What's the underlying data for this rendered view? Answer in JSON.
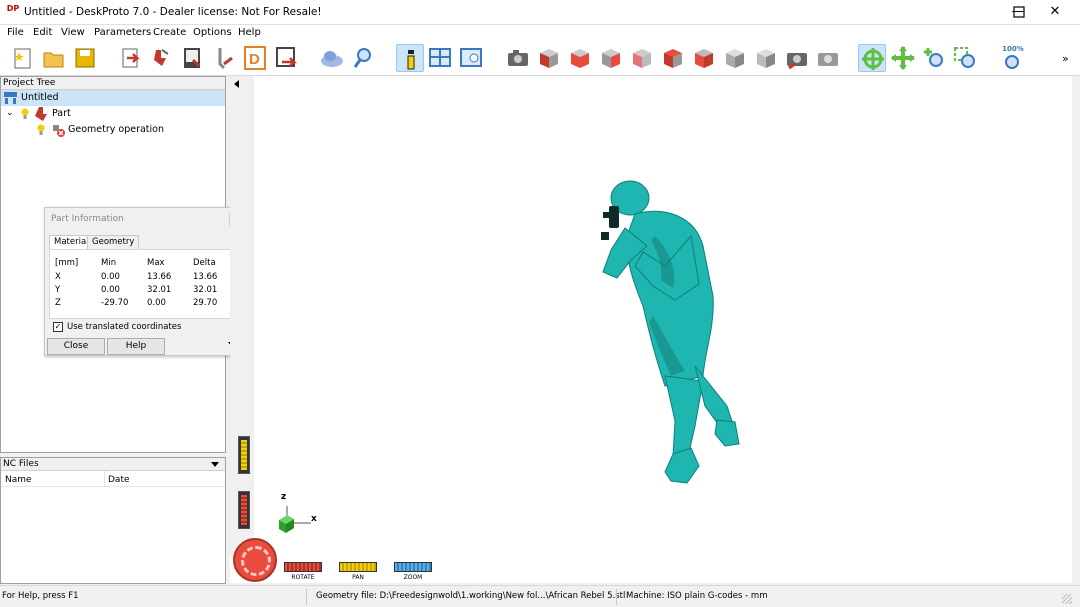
{
  "window": {
    "title": "Untitled - DeskProto 7.0 - Dealer license: Not For Resale!",
    "icon_text": "DP"
  },
  "menu": [
    "File",
    "Edit",
    "View",
    "Parameters",
    "Create",
    "Options",
    "Help"
  ],
  "toolbar": {
    "zoom_label": "100%"
  },
  "project_tree": {
    "header": "Project Tree",
    "root": "Untitled",
    "part": "Part",
    "operation": "Geometry operation"
  },
  "part_info": {
    "title": "Part Information",
    "tabs": [
      "Material",
      "Geometry"
    ],
    "columns": [
      "[mm]",
      "Min",
      "Max",
      "Delta"
    ],
    "rows": [
      [
        "X",
        "0.00",
        "13.66",
        "13.66"
      ],
      [
        "Y",
        "0.00",
        "32.01",
        "32.01"
      ],
      [
        "Z",
        "-29.70",
        "0.00",
        "29.70"
      ]
    ],
    "checkbox_label": "Use translated coordinates",
    "close_label": "Close",
    "help_label": "Help"
  },
  "nc_files": {
    "header": "NC Files",
    "columns": [
      "Name",
      "Date"
    ]
  },
  "viewport": {
    "axis_z": "z",
    "axis_x": "x",
    "controls": [
      "ROTATE",
      "PAN",
      "ZOOM"
    ],
    "model_color": "#1fb5b0"
  },
  "status": {
    "help": "For Help, press F1",
    "geometry": "Geometry file: D:\\Freedesignwold\\1.working\\New fol...\\African Rebel 5.stl",
    "machine": "Machine: ISO plain G-codes - mm"
  }
}
